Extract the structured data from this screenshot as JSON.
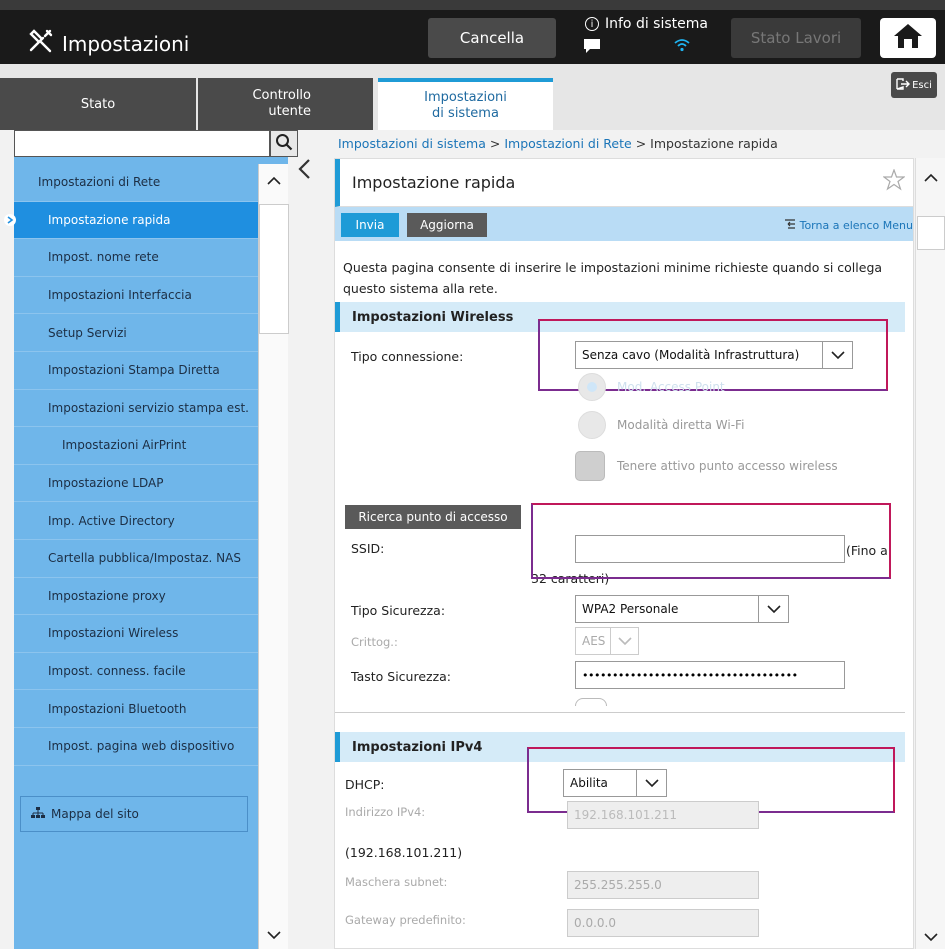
{
  "header": {
    "title": "Impostazioni",
    "cancel_label": "Cancella",
    "sysinfo_label": "Info di sistema",
    "jobs_label": "Stato Lavori"
  },
  "tabs": {
    "stato": "Stato",
    "controllo_l1": "Controllo",
    "controllo_l2": "utente",
    "imp_l1": "Impostazioni",
    "imp_l2": "di sistema",
    "exit_label": "Esci"
  },
  "sidebar": {
    "search_value": "",
    "items": [
      {
        "label": "Impostazioni di Rete"
      },
      {
        "label": "Impostazione rapida"
      },
      {
        "label": "Impost. nome rete"
      },
      {
        "label": "Impostazioni Interfaccia"
      },
      {
        "label": "Setup Servizi"
      },
      {
        "label": "Impostazioni Stampa Diretta"
      },
      {
        "label": "Impostazioni servizio stampa est."
      },
      {
        "label": "Impostazioni AirPrint"
      },
      {
        "label": "Impostazione LDAP"
      },
      {
        "label": "Imp. Active Directory"
      },
      {
        "label": "Cartella pubblica/Impostaz. NAS"
      },
      {
        "label": "Impostazione proxy"
      },
      {
        "label": "Impostazioni Wireless"
      },
      {
        "label": "Impost. conness. facile"
      },
      {
        "label": "Impostazioni Bluetooth"
      },
      {
        "label": "Impost. pagina web dispositivo"
      }
    ],
    "sitemap_label": "Mappa del sito"
  },
  "breadcrumb": {
    "part1": "Impostazioni di sistema",
    "sep": ">",
    "part2": "Impostazioni di Rete",
    "part3": "Impostazione rapida"
  },
  "page": {
    "title": "Impostazione rapida",
    "invia_label": "Invia",
    "aggiorna_label": "Aggiorna",
    "back_menu_label": "Torna a elenco Menu",
    "intro_text": "Questa pagina consente di inserire le impostazioni minime richieste quando si collega questo sistema alla rete."
  },
  "wireless": {
    "section_title": "Impostazioni Wireless",
    "conn_type_label": "Tipo connessione:",
    "conn_type_value": "Senza cavo (Modalità Infrastruttura)",
    "opt_access_point": "Mod. Access Point",
    "opt_wifi_direct": "Modalità diretta Wi-Fi",
    "opt_keep_ap": "Tenere attivo punto accesso wireless",
    "search_ap_label": "Ricerca punto di accesso",
    "ssid_label": "SSID:",
    "ssid_value": "",
    "ssid_hint_a": "(Fino a",
    "ssid_hint_b": "32 caratteri)",
    "security_type_label": "Tipo Sicurezza:",
    "security_type_value": "WPA2 Personale",
    "encryption_label": "Crittog.:",
    "encryption_value": "AES",
    "security_key_label": "Tasto Sicurezza:",
    "security_key_value": "••••••••••••••••••••••••••••••••••••"
  },
  "ipv4": {
    "section_title": "Impostazioni IPv4",
    "dhcp_label": "DHCP:",
    "dhcp_value": "Abilita",
    "address_label": "Indirizzo IPv4:",
    "address_value": "192.168.101.211",
    "address_current": "(192.168.101.211)",
    "subnet_label": "Maschera subnet:",
    "subnet_value": "255.255.255.0",
    "gateway_label": "Gateway predefinito:",
    "gateway_value": "0.0.0.0"
  },
  "colors": {
    "accent": "#1f9bd6",
    "sidebar_bg": "#6fb6ea",
    "sidebar_active": "#1f8fe0",
    "annotation": "#7b2c8f"
  }
}
